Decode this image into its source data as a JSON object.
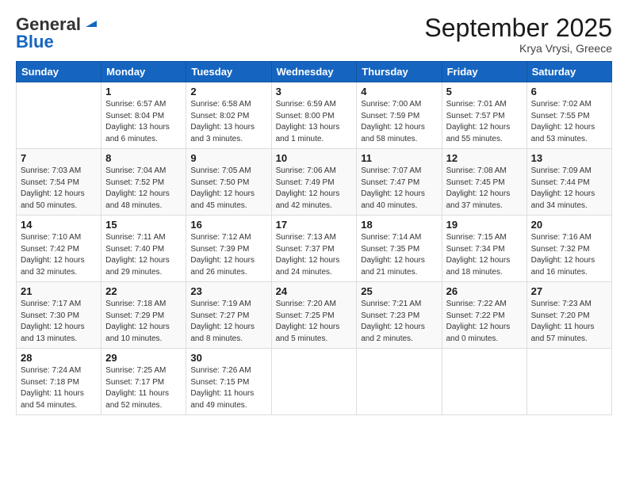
{
  "logo": {
    "line1": "General",
    "line2": "Blue"
  },
  "header": {
    "month": "September 2025",
    "location": "Krya Vrysi, Greece"
  },
  "days_of_week": [
    "Sunday",
    "Monday",
    "Tuesday",
    "Wednesday",
    "Thursday",
    "Friday",
    "Saturday"
  ],
  "weeks": [
    [
      {
        "day": "",
        "info": ""
      },
      {
        "day": "1",
        "info": "Sunrise: 6:57 AM\nSunset: 8:04 PM\nDaylight: 13 hours\nand 6 minutes."
      },
      {
        "day": "2",
        "info": "Sunrise: 6:58 AM\nSunset: 8:02 PM\nDaylight: 13 hours\nand 3 minutes."
      },
      {
        "day": "3",
        "info": "Sunrise: 6:59 AM\nSunset: 8:00 PM\nDaylight: 13 hours\nand 1 minute."
      },
      {
        "day": "4",
        "info": "Sunrise: 7:00 AM\nSunset: 7:59 PM\nDaylight: 12 hours\nand 58 minutes."
      },
      {
        "day": "5",
        "info": "Sunrise: 7:01 AM\nSunset: 7:57 PM\nDaylight: 12 hours\nand 55 minutes."
      },
      {
        "day": "6",
        "info": "Sunrise: 7:02 AM\nSunset: 7:55 PM\nDaylight: 12 hours\nand 53 minutes."
      }
    ],
    [
      {
        "day": "7",
        "info": "Sunrise: 7:03 AM\nSunset: 7:54 PM\nDaylight: 12 hours\nand 50 minutes."
      },
      {
        "day": "8",
        "info": "Sunrise: 7:04 AM\nSunset: 7:52 PM\nDaylight: 12 hours\nand 48 minutes."
      },
      {
        "day": "9",
        "info": "Sunrise: 7:05 AM\nSunset: 7:50 PM\nDaylight: 12 hours\nand 45 minutes."
      },
      {
        "day": "10",
        "info": "Sunrise: 7:06 AM\nSunset: 7:49 PM\nDaylight: 12 hours\nand 42 minutes."
      },
      {
        "day": "11",
        "info": "Sunrise: 7:07 AM\nSunset: 7:47 PM\nDaylight: 12 hours\nand 40 minutes."
      },
      {
        "day": "12",
        "info": "Sunrise: 7:08 AM\nSunset: 7:45 PM\nDaylight: 12 hours\nand 37 minutes."
      },
      {
        "day": "13",
        "info": "Sunrise: 7:09 AM\nSunset: 7:44 PM\nDaylight: 12 hours\nand 34 minutes."
      }
    ],
    [
      {
        "day": "14",
        "info": "Sunrise: 7:10 AM\nSunset: 7:42 PM\nDaylight: 12 hours\nand 32 minutes."
      },
      {
        "day": "15",
        "info": "Sunrise: 7:11 AM\nSunset: 7:40 PM\nDaylight: 12 hours\nand 29 minutes."
      },
      {
        "day": "16",
        "info": "Sunrise: 7:12 AM\nSunset: 7:39 PM\nDaylight: 12 hours\nand 26 minutes."
      },
      {
        "day": "17",
        "info": "Sunrise: 7:13 AM\nSunset: 7:37 PM\nDaylight: 12 hours\nand 24 minutes."
      },
      {
        "day": "18",
        "info": "Sunrise: 7:14 AM\nSunset: 7:35 PM\nDaylight: 12 hours\nand 21 minutes."
      },
      {
        "day": "19",
        "info": "Sunrise: 7:15 AM\nSunset: 7:34 PM\nDaylight: 12 hours\nand 18 minutes."
      },
      {
        "day": "20",
        "info": "Sunrise: 7:16 AM\nSunset: 7:32 PM\nDaylight: 12 hours\nand 16 minutes."
      }
    ],
    [
      {
        "day": "21",
        "info": "Sunrise: 7:17 AM\nSunset: 7:30 PM\nDaylight: 12 hours\nand 13 minutes."
      },
      {
        "day": "22",
        "info": "Sunrise: 7:18 AM\nSunset: 7:29 PM\nDaylight: 12 hours\nand 10 minutes."
      },
      {
        "day": "23",
        "info": "Sunrise: 7:19 AM\nSunset: 7:27 PM\nDaylight: 12 hours\nand 8 minutes."
      },
      {
        "day": "24",
        "info": "Sunrise: 7:20 AM\nSunset: 7:25 PM\nDaylight: 12 hours\nand 5 minutes."
      },
      {
        "day": "25",
        "info": "Sunrise: 7:21 AM\nSunset: 7:23 PM\nDaylight: 12 hours\nand 2 minutes."
      },
      {
        "day": "26",
        "info": "Sunrise: 7:22 AM\nSunset: 7:22 PM\nDaylight: 12 hours\nand 0 minutes."
      },
      {
        "day": "27",
        "info": "Sunrise: 7:23 AM\nSunset: 7:20 PM\nDaylight: 11 hours\nand 57 minutes."
      }
    ],
    [
      {
        "day": "28",
        "info": "Sunrise: 7:24 AM\nSunset: 7:18 PM\nDaylight: 11 hours\nand 54 minutes."
      },
      {
        "day": "29",
        "info": "Sunrise: 7:25 AM\nSunset: 7:17 PM\nDaylight: 11 hours\nand 52 minutes."
      },
      {
        "day": "30",
        "info": "Sunrise: 7:26 AM\nSunset: 7:15 PM\nDaylight: 11 hours\nand 49 minutes."
      },
      {
        "day": "",
        "info": ""
      },
      {
        "day": "",
        "info": ""
      },
      {
        "day": "",
        "info": ""
      },
      {
        "day": "",
        "info": ""
      }
    ]
  ]
}
